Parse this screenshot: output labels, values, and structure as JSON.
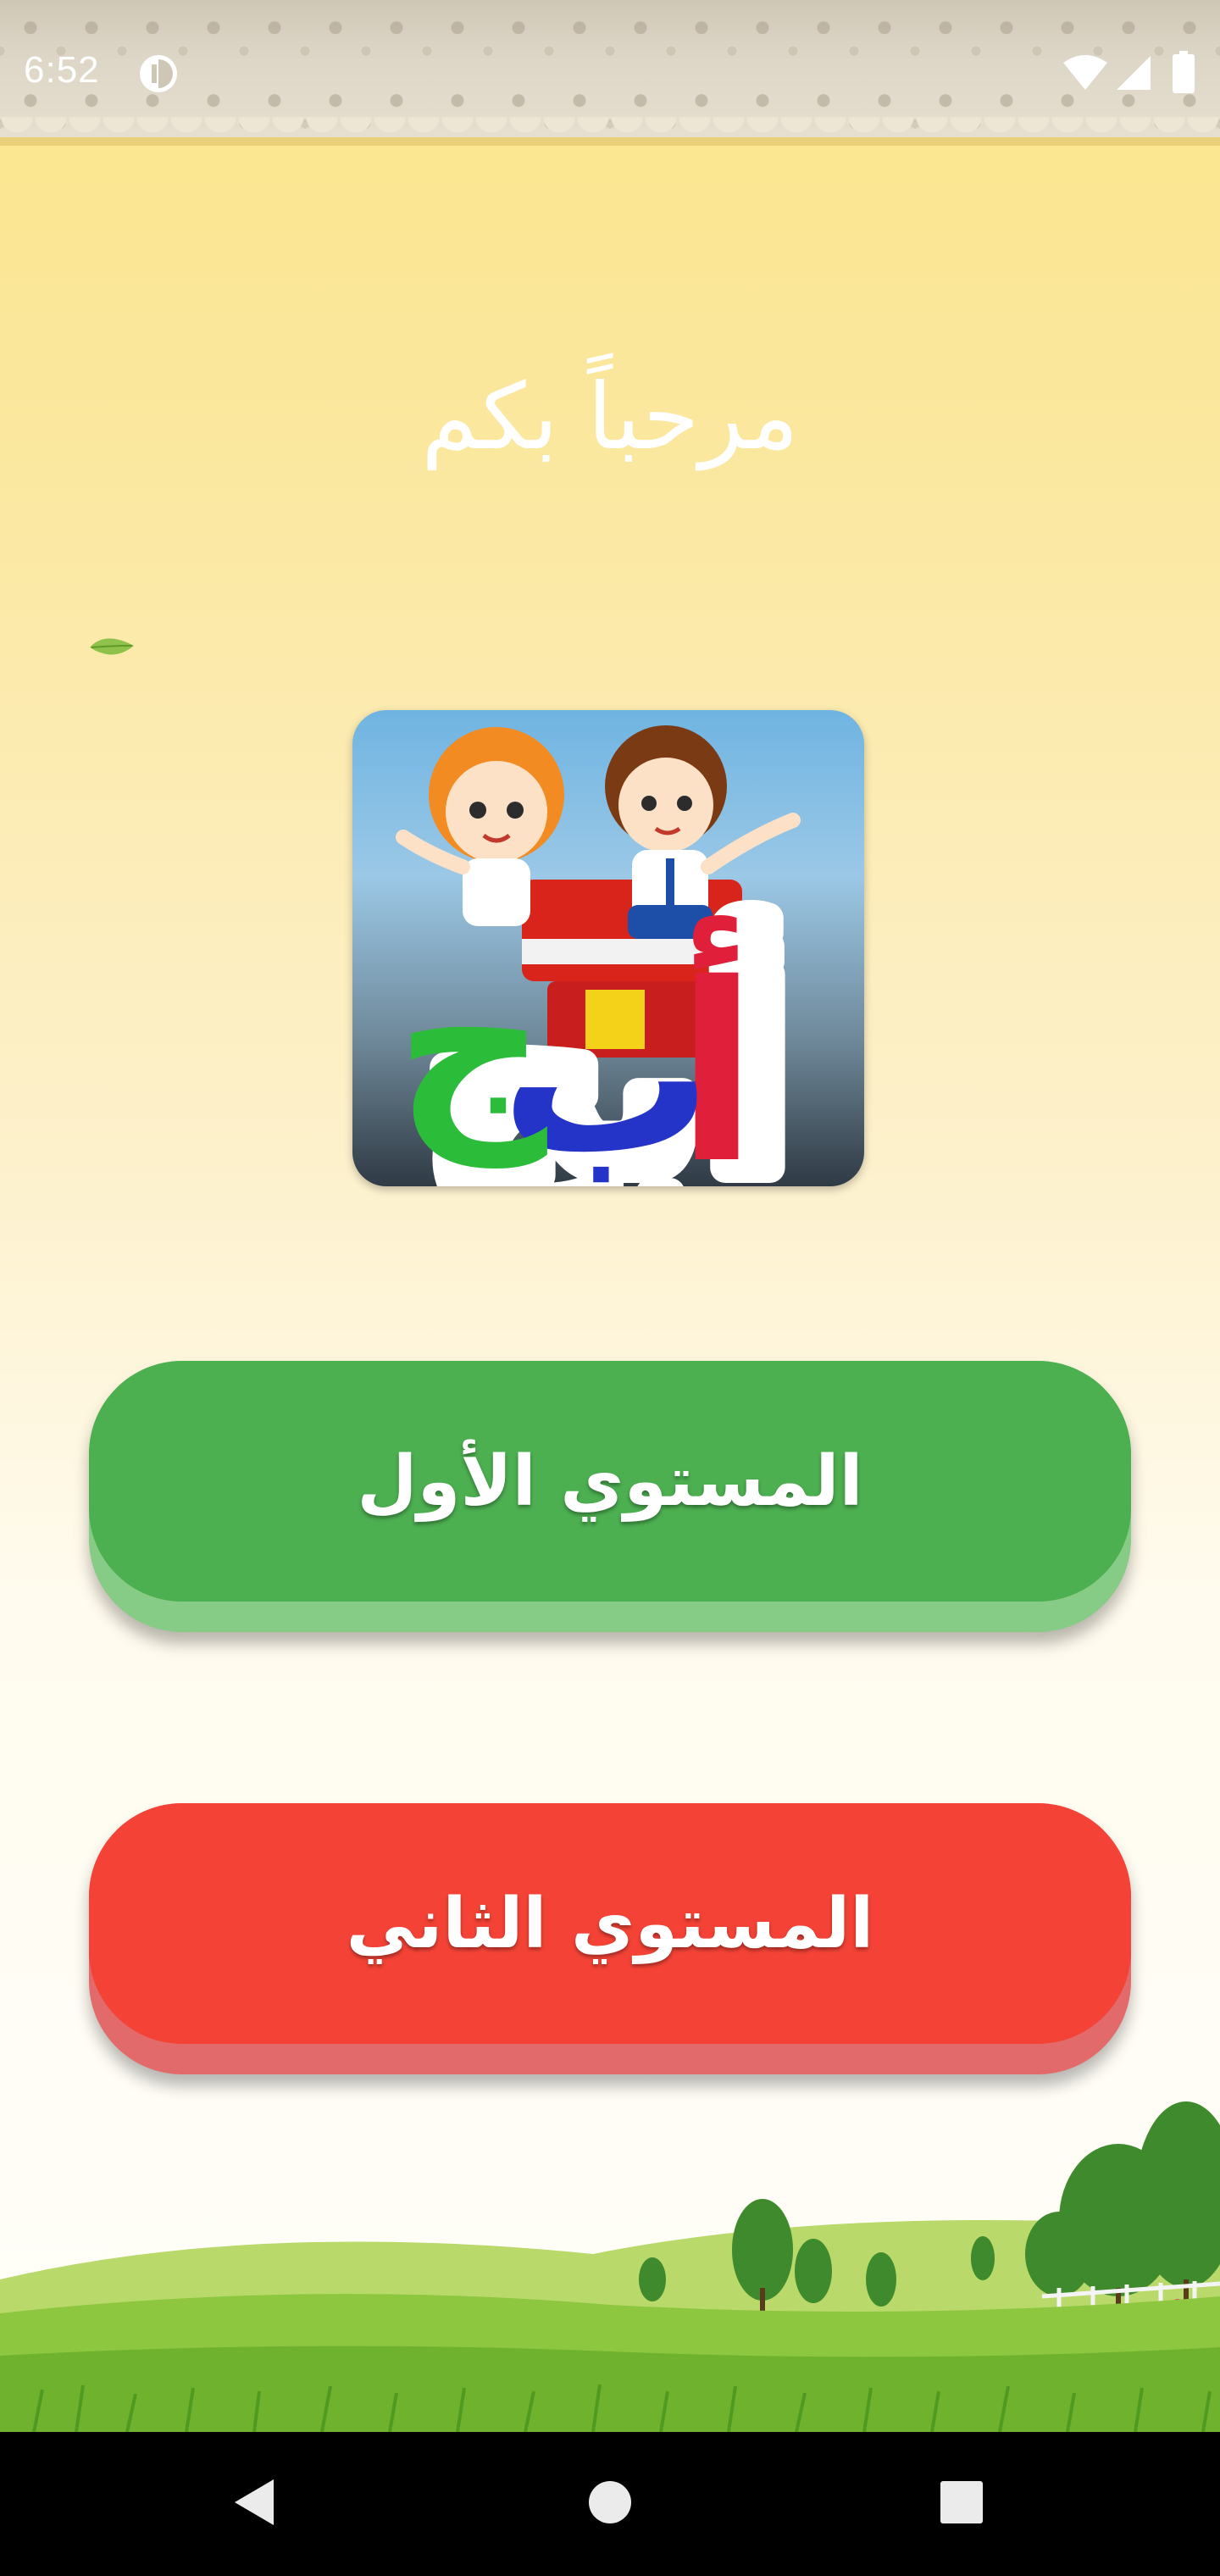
{
  "status_bar": {
    "time": "6:52",
    "icons": [
      "data-saver-icon",
      "wifi-icon",
      "cellular-signal-icon",
      "battery-icon"
    ]
  },
  "welcome_text": "مرحباً بكم",
  "app_logo": {
    "name": "app-logo-abjad",
    "letters": "أبج"
  },
  "buttons": {
    "level_one": "المستوي الأول",
    "level_two": "المستوي الثاني"
  },
  "colors": {
    "level_one_button": "#4caf50",
    "level_two_button": "#f44336",
    "background_top": "#fbe58a",
    "text": "#ffffff"
  },
  "nav_bar": {
    "icons": [
      "back-icon",
      "home-icon",
      "recents-icon"
    ]
  }
}
